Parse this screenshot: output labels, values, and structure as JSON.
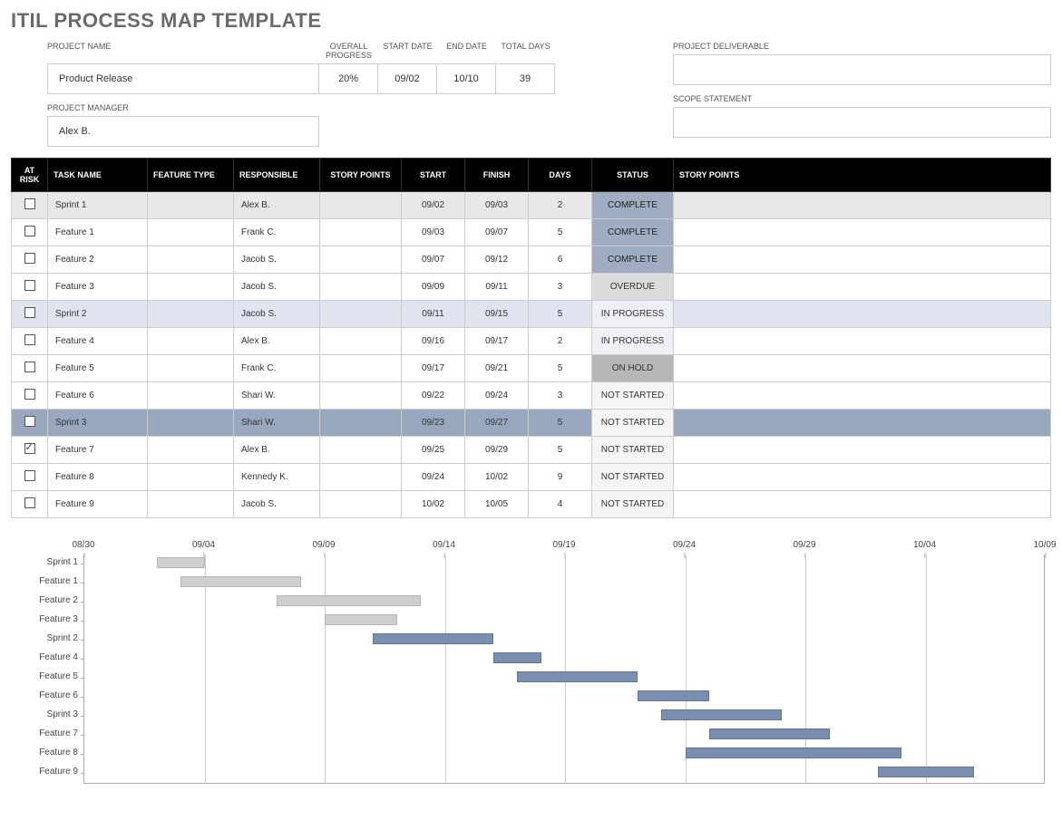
{
  "title": "ITIL PROCESS MAP TEMPLATE",
  "header": {
    "project_name_label": "PROJECT NAME",
    "project_name": "Product Release",
    "progress_label": "OVERALL PROGRESS",
    "progress": "20%",
    "start_label": "START DATE",
    "start": "09/02",
    "end_label": "END DATE",
    "end": "10/10",
    "totaldays_label": "TOTAL DAYS",
    "totaldays": "39",
    "pm_label": "PROJECT MANAGER",
    "pm": "Alex B.",
    "deliverable_label": "PROJECT DELIVERABLE",
    "deliverable": "",
    "scope_label": "SCOPE STATEMENT",
    "scope": ""
  },
  "table": {
    "headers": {
      "risk": "AT RISK",
      "task": "TASK NAME",
      "feature": "FEATURE TYPE",
      "responsible": "RESPONSIBLE",
      "sp": "STORY POINTS",
      "start": "START",
      "finish": "FINISH",
      "days": "DAYS",
      "status": "STATUS",
      "sp2": "STORY POINTS"
    },
    "rows": [
      {
        "risk": false,
        "task": "Sprint 1",
        "feature": "",
        "responsible": "Alex B.",
        "sp": "",
        "start": "09/02",
        "finish": "09/03",
        "days": "2",
        "status": "COMPLETE",
        "status_cls": "st-complete",
        "row_cls": "shade1"
      },
      {
        "risk": false,
        "task": "Feature 1",
        "feature": "",
        "responsible": "Frank C.",
        "sp": "",
        "start": "09/03",
        "finish": "09/07",
        "days": "5",
        "status": "COMPLETE",
        "status_cls": "st-complete",
        "row_cls": ""
      },
      {
        "risk": false,
        "task": "Feature 2",
        "feature": "",
        "responsible": "Jacob S.",
        "sp": "",
        "start": "09/07",
        "finish": "09/12",
        "days": "6",
        "status": "COMPLETE",
        "status_cls": "st-complete",
        "row_cls": ""
      },
      {
        "risk": false,
        "task": "Feature 3",
        "feature": "",
        "responsible": "Jacob S.",
        "sp": "",
        "start": "09/09",
        "finish": "09/11",
        "days": "3",
        "status": "OVERDUE",
        "status_cls": "st-overdue",
        "row_cls": ""
      },
      {
        "risk": false,
        "task": "Sprint 2",
        "feature": "",
        "responsible": "Jacob S.",
        "sp": "",
        "start": "09/11",
        "finish": "09/15",
        "days": "5",
        "status": "IN PROGRESS",
        "status_cls": "st-inprogress",
        "row_cls": "shade2"
      },
      {
        "risk": false,
        "task": "Feature 4",
        "feature": "",
        "responsible": "Alex B.",
        "sp": "",
        "start": "09/16",
        "finish": "09/17",
        "days": "2",
        "status": "IN PROGRESS",
        "status_cls": "st-inprogress",
        "row_cls": ""
      },
      {
        "risk": false,
        "task": "Feature 5",
        "feature": "",
        "responsible": "Frank C.",
        "sp": "",
        "start": "09/17",
        "finish": "09/21",
        "days": "5",
        "status": "ON HOLD",
        "status_cls": "st-onhold",
        "row_cls": ""
      },
      {
        "risk": false,
        "task": "Feature 6",
        "feature": "",
        "responsible": "Shari W.",
        "sp": "",
        "start": "09/22",
        "finish": "09/24",
        "days": "3",
        "status": "NOT STARTED",
        "status_cls": "st-notstarted",
        "row_cls": ""
      },
      {
        "risk": false,
        "task": "Sprint 3",
        "feature": "",
        "responsible": "Shari W.",
        "sp": "",
        "start": "09/23",
        "finish": "09/27",
        "days": "5",
        "status": "NOT STARTED",
        "status_cls": "st-notstarted",
        "row_cls": "shade3"
      },
      {
        "risk": true,
        "task": "Feature 7",
        "feature": "",
        "responsible": "Alex B.",
        "sp": "",
        "start": "09/25",
        "finish": "09/29",
        "days": "5",
        "status": "NOT STARTED",
        "status_cls": "st-notstarted",
        "row_cls": ""
      },
      {
        "risk": false,
        "task": "Feature 8",
        "feature": "",
        "responsible": "Kennedy K.",
        "sp": "",
        "start": "09/24",
        "finish": "10/02",
        "days": "9",
        "status": "NOT STARTED",
        "status_cls": "st-notstarted",
        "row_cls": ""
      },
      {
        "risk": false,
        "task": "Feature 9",
        "feature": "",
        "responsible": "Jacob S.",
        "sp": "",
        "start": "10/02",
        "finish": "10/05",
        "days": "4",
        "status": "NOT STARTED",
        "status_cls": "st-notstarted",
        "row_cls": ""
      }
    ]
  },
  "chart_data": {
    "type": "bar",
    "title": "",
    "x_start": "08/30",
    "x_end": "10/09",
    "ticks": [
      "08/30",
      "09/04",
      "09/09",
      "09/14",
      "09/19",
      "09/24",
      "09/29",
      "10/04",
      "10/09"
    ],
    "rows": [
      {
        "label": "Sprint 1",
        "start": "09/02",
        "end": "09/03",
        "color": "grey"
      },
      {
        "label": "Feature 1",
        "start": "09/03",
        "end": "09/07",
        "color": "grey"
      },
      {
        "label": "Feature 2",
        "start": "09/07",
        "end": "09/12",
        "color": "grey"
      },
      {
        "label": "Feature 3",
        "start": "09/09",
        "end": "09/11",
        "color": "grey"
      },
      {
        "label": "Sprint 2",
        "start": "09/11",
        "end": "09/15",
        "color": "blue"
      },
      {
        "label": "Feature 4",
        "start": "09/16",
        "end": "09/17",
        "color": "blue"
      },
      {
        "label": "Feature 5",
        "start": "09/17",
        "end": "09/21",
        "color": "blue"
      },
      {
        "label": "Feature 6",
        "start": "09/22",
        "end": "09/24",
        "color": "blue"
      },
      {
        "label": "Sprint 3",
        "start": "09/23",
        "end": "09/27",
        "color": "blue"
      },
      {
        "label": "Feature 7",
        "start": "09/25",
        "end": "09/29",
        "color": "blue"
      },
      {
        "label": "Feature 8",
        "start": "09/24",
        "end": "10/02",
        "color": "blue"
      },
      {
        "label": "Feature 9",
        "start": "10/02",
        "end": "10/05",
        "color": "blue"
      }
    ]
  }
}
